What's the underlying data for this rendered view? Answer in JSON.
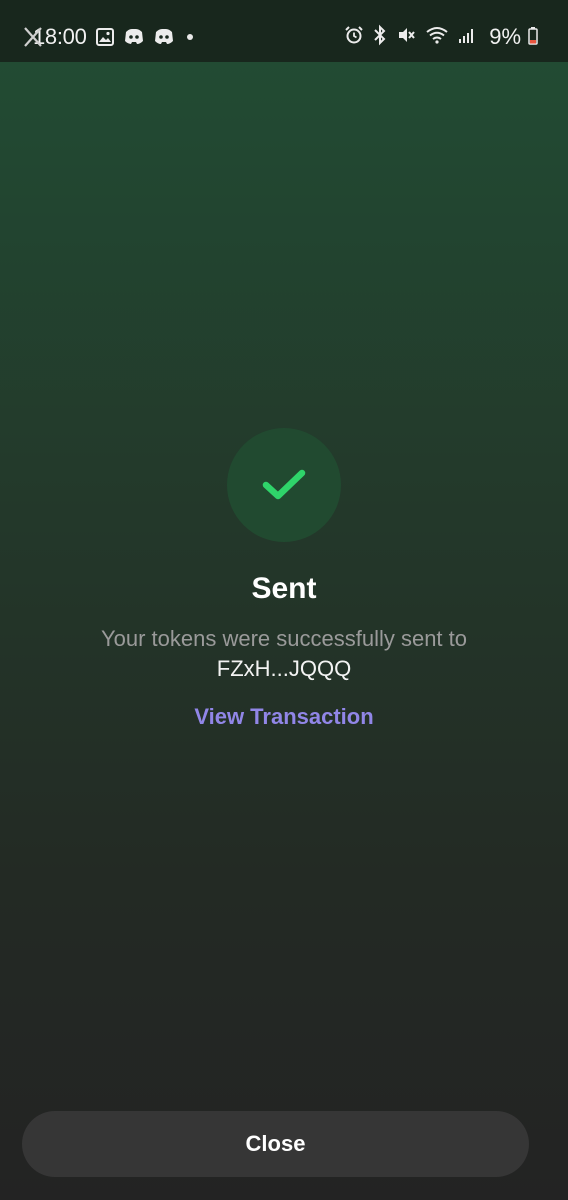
{
  "status_bar": {
    "time": "18:00",
    "battery_percent": "9%",
    "icons": [
      "close-icon",
      "image-icon",
      "discord-icon",
      "discord-icon",
      "notification-dot",
      "alarm-icon",
      "bluetooth-icon",
      "mute-icon",
      "wifi-icon",
      "signal-icon",
      "battery-icon"
    ]
  },
  "result": {
    "icon": "checkmark-icon",
    "title": "Sent",
    "message": "Your tokens were successfully sent to",
    "address": "FZxH...JQQQ",
    "link_label": "View Transaction"
  },
  "footer": {
    "close_label": "Close"
  },
  "colors": {
    "accent": "#9186e7",
    "success": "#2fd46a",
    "button_bg": "#363636"
  }
}
